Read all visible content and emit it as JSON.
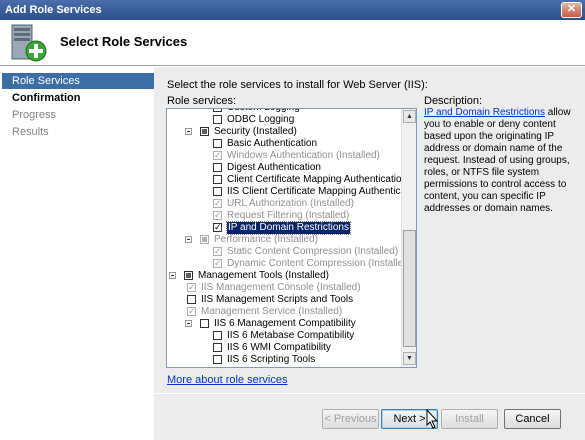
{
  "window": {
    "title": "Add Role Services",
    "close_glyph": "✕"
  },
  "header": {
    "title": "Select Role Services",
    "icon": "server-add-icon"
  },
  "nav": [
    {
      "label": "Role Services",
      "state": "active"
    },
    {
      "label": "Confirmation",
      "state": "current"
    },
    {
      "label": "Progress",
      "state": "disabled"
    },
    {
      "label": "Results",
      "state": "disabled"
    }
  ],
  "main": {
    "instruction": "Select the role services to install for Web Server (IIS):",
    "role_services_label": "Role services:",
    "description_heading": "Description:",
    "description_link": "IP and Domain Restrictions",
    "description_text": " allow you to enable or deny content based upon the originating IP address or domain name of the request. Instead of using groups, roles, or NTFS file system permissions to control access to content, you can specific IP addresses or domain names.",
    "more_link": "More about role services",
    "tree": [
      {
        "label": "Custom Logging",
        "level": 3,
        "check": "none",
        "gray": false
      },
      {
        "label": "ODBC Logging",
        "level": 3,
        "check": "none",
        "gray": false
      },
      {
        "label": "Security  (Installed)",
        "level": 2,
        "check": "partial",
        "gray": false,
        "expander": true
      },
      {
        "label": "Basic Authentication",
        "level": 3,
        "check": "none",
        "gray": false
      },
      {
        "label": "Windows Authentication  (Installed)",
        "level": 3,
        "check": "checked",
        "gray": true
      },
      {
        "label": "Digest Authentication",
        "level": 3,
        "check": "none",
        "gray": false
      },
      {
        "label": "Client Certificate Mapping Authentication",
        "level": 3,
        "check": "none",
        "gray": false
      },
      {
        "label": "IIS Client Certificate Mapping Authentication",
        "level": 3,
        "check": "none",
        "gray": false
      },
      {
        "label": "URL Authorization  (Installed)",
        "level": 3,
        "check": "checked",
        "gray": true
      },
      {
        "label": "Request Filtering  (Installed)",
        "level": 3,
        "check": "checked",
        "gray": true
      },
      {
        "label": "IP and Domain Restrictions",
        "level": 3,
        "check": "checked",
        "gray": false,
        "selected": true
      },
      {
        "label": "Performance  (Installed)",
        "level": 2,
        "check": "partial",
        "gray": true,
        "expander": true
      },
      {
        "label": "Static Content Compression  (Installed)",
        "level": 3,
        "check": "checked",
        "gray": true
      },
      {
        "label": "Dynamic Content Compression  (Installed)",
        "level": 3,
        "check": "checked",
        "gray": true
      },
      {
        "label": "Management Tools  (Installed)",
        "level": 1,
        "check": "partial",
        "gray": false,
        "expander": true
      },
      {
        "label": "IIS Management Console  (Installed)",
        "level": 2,
        "check": "checked",
        "gray": true
      },
      {
        "label": "IIS Management Scripts and Tools",
        "level": 2,
        "check": "none",
        "gray": false
      },
      {
        "label": "Management Service  (Installed)",
        "level": 2,
        "check": "checked",
        "gray": true
      },
      {
        "label": "IIS 6 Management Compatibility",
        "level": 2,
        "check": "none",
        "gray": false,
        "expander": true
      },
      {
        "label": "IIS 6 Metabase Compatibility",
        "level": 3,
        "check": "none",
        "gray": false
      },
      {
        "label": "IIS 6 WMI Compatibility",
        "level": 3,
        "check": "none",
        "gray": false
      },
      {
        "label": "IIS 6 Scripting Tools",
        "level": 3,
        "check": "none",
        "gray": false
      }
    ]
  },
  "buttons": {
    "previous": "< Previous",
    "next": "Next >",
    "install": "Install",
    "cancel": "Cancel"
  },
  "colors": {
    "title_bar": "#2b4f8c",
    "nav_active": "#3a6ea5",
    "link": "#0033cc",
    "selection": "#0a246a"
  }
}
